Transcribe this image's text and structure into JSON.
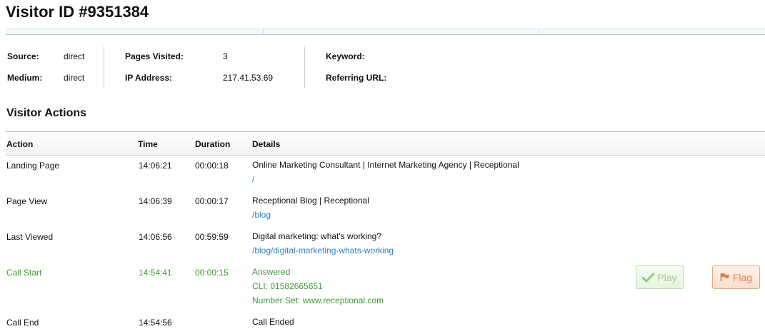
{
  "page": {
    "title": "Visitor ID #9351384"
  },
  "summary": {
    "source_label": "Source:",
    "source_value": "direct",
    "medium_label": "Medium:",
    "medium_value": "direct",
    "pages_label": "Pages Visited:",
    "pages_value": "3",
    "ip_label": "IP Address:",
    "ip_value": "217.41.53.69",
    "keyword_label": "Keyword:",
    "keyword_value": "",
    "referring_label": "Referring URL:",
    "referring_value": ""
  },
  "actions": {
    "title": "Visitor Actions",
    "headers": {
      "action": "Action",
      "time": "Time",
      "duration": "Duration",
      "details": "Details"
    },
    "rows": [
      {
        "action": "Landing Page",
        "time": "14:06:21",
        "duration": "00:00:18",
        "detail1": "Online Marketing Consultant | Internet Marketing Agency | Receptional",
        "detail2": "/"
      },
      {
        "action": "Page View",
        "time": "14:06:39",
        "duration": "00:00:17",
        "detail1": "Receptional Blog | Receptional",
        "detail2": "/blog"
      },
      {
        "action": "Last Viewed",
        "time": "14:06:56",
        "duration": "00:59:59",
        "detail1": "Digital marketing: what's working?",
        "detail2": "/blog/digital-marketing-whats-working"
      },
      {
        "action": "Call Start",
        "time": "14:54:41",
        "duration": "00:00:15",
        "detail1": "Answered",
        "detail2": "CLI: 01582665651",
        "detail3": "Number Set: www.receptional.com",
        "play_label": "Play",
        "flag_label": "Flag"
      },
      {
        "action": "Call End",
        "time": "14:54:56",
        "duration": "",
        "detail1": "Call Ended"
      }
    ]
  },
  "colors": {
    "link": "#2d7fc0",
    "call_green": "#3f9a36",
    "flag_orange": "#e77d4a"
  }
}
